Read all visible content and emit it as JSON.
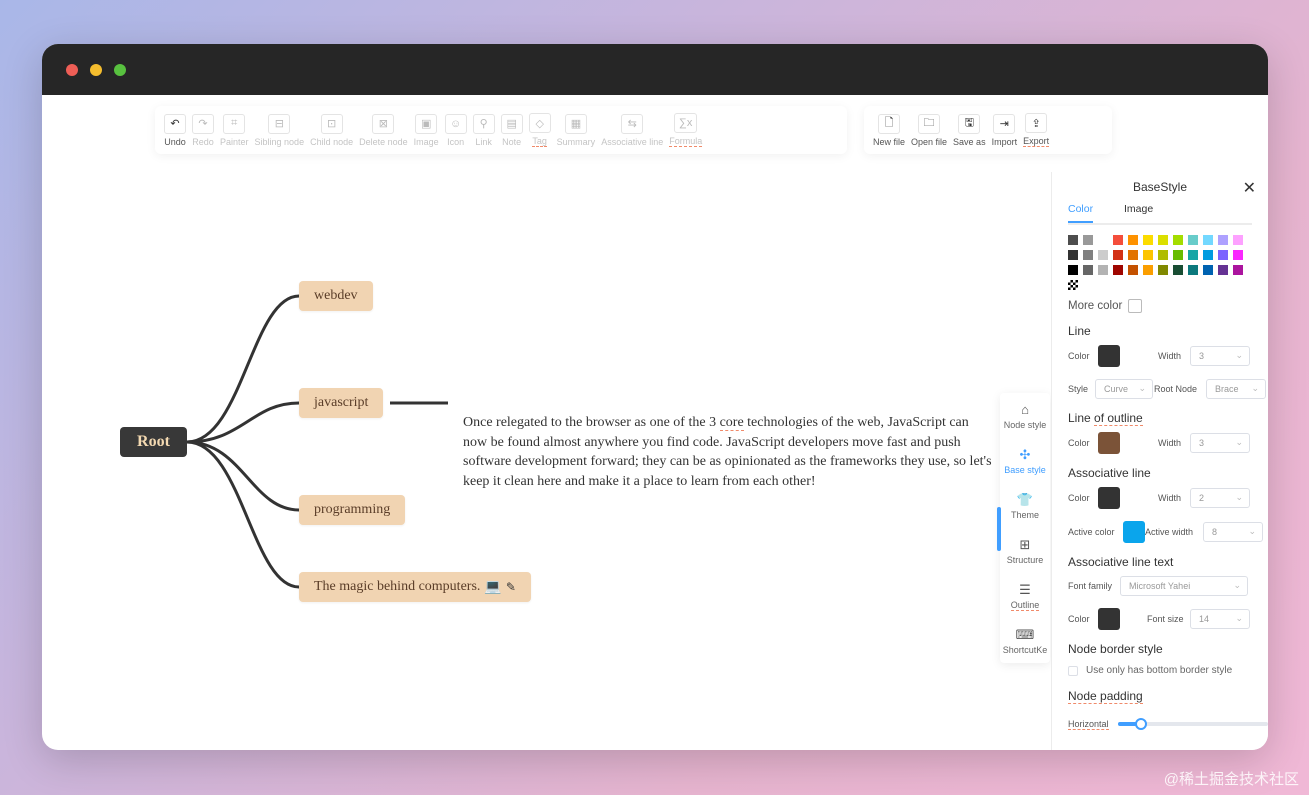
{
  "window": {
    "colors": {
      "titlebar": "#262626",
      "close": "#ee5e56",
      "minimize": "#f5bd2e",
      "maximize": "#58c13f"
    }
  },
  "toolbar": {
    "main_buttons": [
      {
        "label": "Undo",
        "icon": "undo-icon",
        "glyph": "↶",
        "enabled": true
      },
      {
        "label": "Redo",
        "icon": "redo-icon",
        "glyph": "↷",
        "enabled": false
      },
      {
        "label": "Painter",
        "icon": "painter-icon",
        "glyph": "⌗",
        "enabled": false
      },
      {
        "label": "Sibling node",
        "icon": "sibling-node-icon",
        "glyph": "⊟",
        "enabled": false
      },
      {
        "label": "Child node",
        "icon": "child-node-icon",
        "glyph": "⊡",
        "enabled": false
      },
      {
        "label": "Delete node",
        "icon": "delete-node-icon",
        "glyph": "⊠",
        "enabled": false
      },
      {
        "label": "Image",
        "icon": "image-icon",
        "glyph": "▣",
        "enabled": false
      },
      {
        "label": "Icon",
        "icon": "smiley-icon",
        "glyph": "☺",
        "enabled": false
      },
      {
        "label": "Link",
        "icon": "link-icon",
        "glyph": "⚲",
        "enabled": false
      },
      {
        "label": "Note",
        "icon": "note-icon",
        "glyph": "▤",
        "enabled": false
      },
      {
        "label": "Tag",
        "icon": "tag-icon",
        "glyph": "◇",
        "enabled": false,
        "underline": true
      },
      {
        "label": "Summary",
        "icon": "summary-icon",
        "glyph": "▦",
        "enabled": false
      },
      {
        "label": "Associative line",
        "icon": "associative-line-icon",
        "glyph": "⇆",
        "enabled": false
      },
      {
        "label": "Formula",
        "icon": "formula-icon",
        "glyph": "∑x",
        "enabled": false,
        "underline": true
      }
    ],
    "file_buttons": [
      {
        "label": "New file",
        "icon": "new-file-icon",
        "glyph": "🗋"
      },
      {
        "label": "Open file",
        "icon": "open-folder-icon",
        "glyph": "🗀"
      },
      {
        "label": "Save as",
        "icon": "save-icon",
        "glyph": "🖫"
      },
      {
        "label": "Import",
        "icon": "import-icon",
        "glyph": "⇥"
      },
      {
        "label": "Export",
        "icon": "export-icon",
        "glyph": "⇪",
        "underline": true
      }
    ]
  },
  "mindmap": {
    "root": "Root",
    "children": [
      "webdev",
      "javascript",
      "programming",
      "The magic behind computers."
    ],
    "child_emoji": "💻",
    "note_text_parts": [
      "Once relegated to the browser as one of the 3 ",
      "core",
      " technologies of the web, JavaScript can now be found almost anywhere you find code. JavaScript developers move fast and push software development forward; they can be as opinionated as the frameworks they use, so let's keep it clean here and make it a place to learn from each other!"
    ],
    "colors": {
      "edge": "#333333",
      "node_bg": "#f1d4b2",
      "root_bg": "#383838",
      "root_text": "#f3d9b1"
    }
  },
  "sidetabs": [
    {
      "label": "Node style",
      "icon": "node-style-icon",
      "glyph": "⌂",
      "active": false
    },
    {
      "label": "Base style",
      "icon": "base-style-icon",
      "glyph": "✣",
      "active": true
    },
    {
      "label": "Theme",
      "icon": "theme-shirt-icon",
      "glyph": "👕",
      "active": false
    },
    {
      "label": "Structure",
      "icon": "structure-icon",
      "glyph": "⊞",
      "active": false
    },
    {
      "label": "Outline",
      "icon": "outline-icon",
      "glyph": "☰",
      "active": false,
      "underline": true
    },
    {
      "label": "ShortcutKe",
      "icon": "keyboard-icon",
      "glyph": "⌨",
      "active": false
    }
  ],
  "panel": {
    "title": "BaseStyle",
    "tabs": [
      "Color",
      "Image"
    ],
    "active_tab": "Color",
    "palette_rows": [
      [
        "#4d4d4d",
        "#999999",
        "#ffffff",
        "#f44e3b",
        "#fe9200",
        "#fcdc00",
        "#dbdf00",
        "#a4dd00",
        "#68ccca",
        "#73d8ff",
        "#aea1ff",
        "#fda1ff"
      ],
      [
        "#333333",
        "#808080",
        "#cccccc",
        "#d33115",
        "#e27300",
        "#fcc400",
        "#b0bc00",
        "#68bc00",
        "#16a5a5",
        "#009ce0",
        "#7b64ff",
        "#fa28ff"
      ],
      [
        "#000000",
        "#666666",
        "#b3b3b3",
        "#9f0500",
        "#c45100",
        "#fb9e00",
        "#808900",
        "#194d33",
        "#0c797d",
        "#0062b1",
        "#653294",
        "#ab149e"
      ]
    ],
    "more_color": "More color",
    "line": {
      "title": "Line",
      "color_label": "Color",
      "color": "#333333",
      "width_label": "Width",
      "width": "3",
      "style_label": "Style",
      "style": "Curve",
      "root_node_label": "Root Node",
      "root_node": "Brace"
    },
    "outline": {
      "title_parts": [
        "Line ",
        "of outline"
      ],
      "color_label": "Color",
      "color": "#7b5338",
      "width_label": "Width",
      "width": "3"
    },
    "associative": {
      "title": "Associative line",
      "color_label": "Color",
      "color": "#333333",
      "width_label": "Width",
      "width": "2",
      "active_color_label": "Active color",
      "active_color": "#0aa5ec",
      "active_width_label": "Active width",
      "active_width": "8"
    },
    "associative_text": {
      "title": "Associative line text",
      "font_family_label": "Font family",
      "font_family": "Microsoft Yahei",
      "color_label": "Color",
      "color": "#333333",
      "font_size_label": "Font size",
      "font_size": "14"
    },
    "border": {
      "title": "Node border style",
      "checkbox_label": "Use only has bottom border style"
    },
    "padding": {
      "title": "Node padding",
      "horizontal_label": "Horizontal",
      "horizontal_fraction": 0.15
    }
  },
  "watermark": "@稀土掘金技术社区"
}
